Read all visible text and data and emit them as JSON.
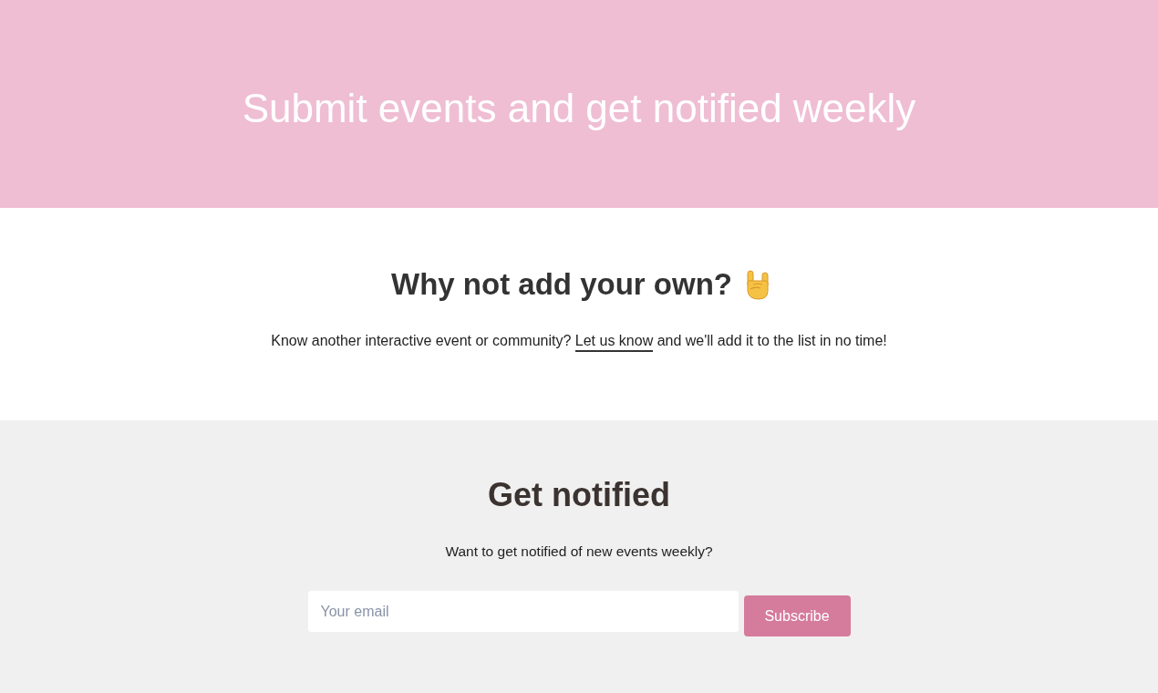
{
  "hero": {
    "title": "Submit events and get notified weekly"
  },
  "add_section": {
    "heading": "Why not add your own?",
    "text_before": "Know another interactive event or community?",
    "link": "Let us know",
    "text_after": "and we'll add it to the list in no time!"
  },
  "notify_section": {
    "heading": "Get notified",
    "text": "Want to get notified of new events weekly?",
    "email_field": {
      "placeholder": "Your email"
    },
    "button": "Subscribe"
  }
}
